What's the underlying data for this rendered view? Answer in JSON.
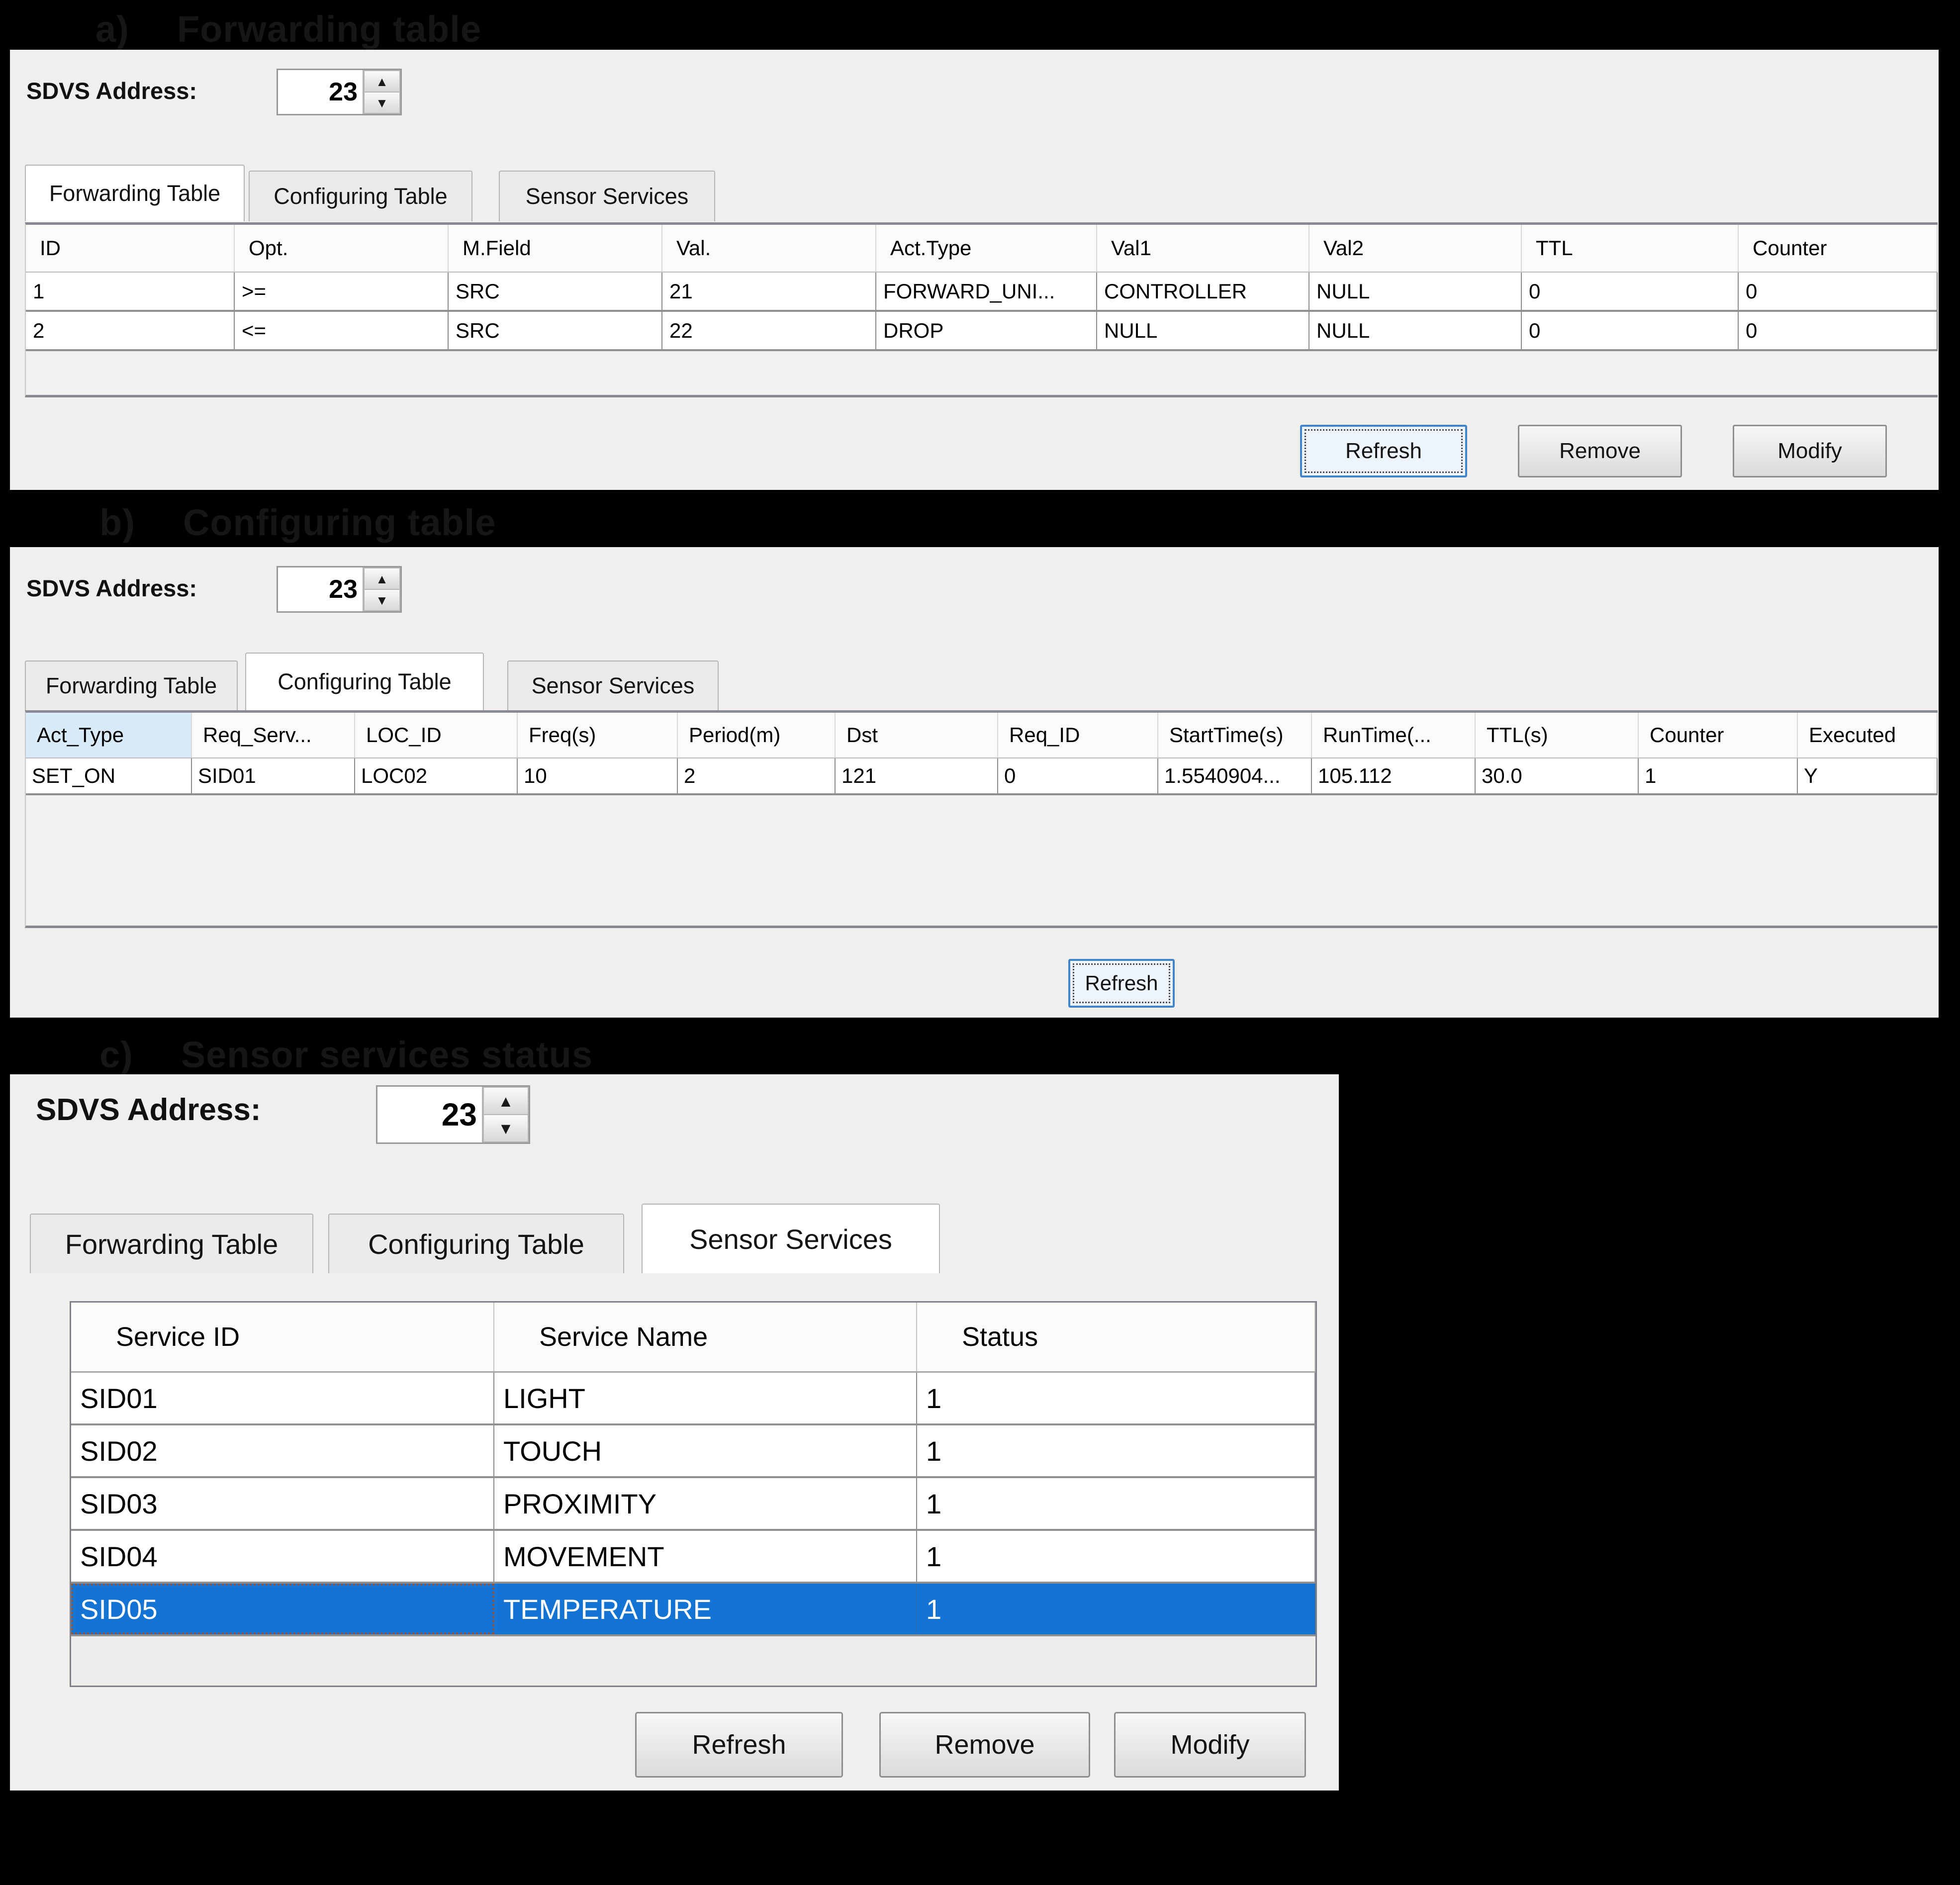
{
  "captions": {
    "a_marker": "a)",
    "a_text": "Forwarding table",
    "b_marker": "b)",
    "b_text": "Configuring table",
    "c_marker": "c)",
    "c_text": "Sensor services status"
  },
  "address": {
    "label": "SDVS Address:",
    "value": "23"
  },
  "tabs": [
    "Forwarding Table",
    "Configuring Table",
    "Sensor Services"
  ],
  "panel_a": {
    "active_tab": "Forwarding Table",
    "columns": [
      "ID",
      "Opt.",
      "M.Field",
      "Val.",
      "Act.Type",
      "Val1",
      "Val2",
      "TTL",
      "Counter"
    ],
    "rows": [
      [
        "1",
        ">=",
        "SRC",
        "21",
        "FORWARD_UNI...",
        "CONTROLLER",
        "NULL",
        "0",
        "0"
      ],
      [
        "2",
        "<=",
        "SRC",
        "22",
        "DROP",
        "NULL",
        "NULL",
        "0",
        "0"
      ]
    ],
    "buttons": [
      "Refresh",
      "Remove",
      "Modify"
    ]
  },
  "panel_b": {
    "active_tab": "Configuring Table",
    "columns": [
      "Act_Type",
      "Req_Serv...",
      "LOC_ID",
      "Freq(s)",
      "Period(m)",
      "Dst",
      "Req_ID",
      "StartTime(s)",
      "RunTime(...",
      "TTL(s)",
      "Counter",
      "Executed"
    ],
    "rows": [
      [
        "SET_ON",
        "SID01",
        "LOC02",
        "10",
        "2",
        "121",
        "0",
        "1.5540904...",
        "105.112",
        "30.0",
        "1",
        "Y"
      ]
    ],
    "buttons": [
      "Refresh"
    ]
  },
  "panel_c": {
    "active_tab": "Sensor Services",
    "columns": [
      "Service ID",
      "Service Name",
      "Status"
    ],
    "rows": [
      [
        "SID01",
        "LIGHT",
        "1"
      ],
      [
        "SID02",
        "TOUCH",
        "1"
      ],
      [
        "SID03",
        "PROXIMITY",
        "1"
      ],
      [
        "SID04",
        "MOVEMENT",
        "1"
      ],
      [
        "SID05",
        "TEMPERATURE",
        "1"
      ]
    ],
    "selected_row": 4,
    "buttons": [
      "Refresh",
      "Remove",
      "Modify"
    ]
  },
  "colors": {
    "selection": "#1474d4",
    "focus_border": "#4184c8",
    "header_highlight": "#d9eafb"
  }
}
